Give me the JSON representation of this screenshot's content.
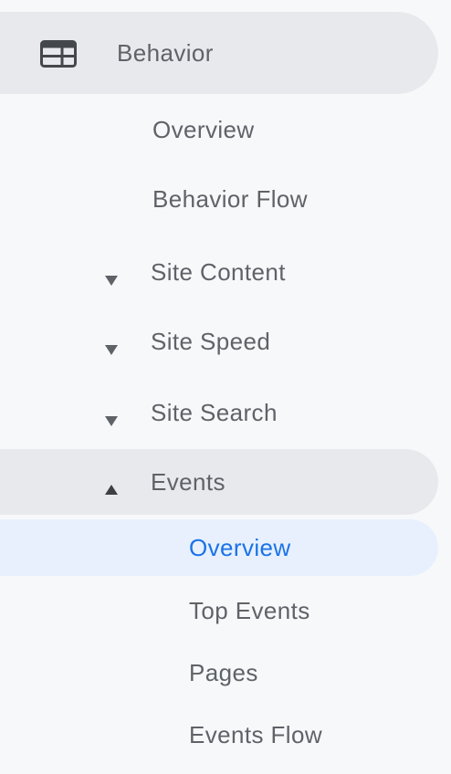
{
  "section": {
    "icon": "web-layout-icon",
    "label": "Behavior"
  },
  "items": {
    "overview": "Overview",
    "behavior_flow": "Behavior Flow"
  },
  "groups": {
    "site_content": {
      "label": "Site Content",
      "icon": "caret-down-icon"
    },
    "site_speed": {
      "label": "Site Speed",
      "icon": "caret-down-icon"
    },
    "site_search": {
      "label": "Site Search",
      "icon": "caret-down-icon"
    },
    "events": {
      "label": "Events",
      "icon": "caret-up-icon",
      "children": {
        "overview": "Overview",
        "top_events": "Top Events",
        "pages": "Pages",
        "events_flow": "Events Flow"
      }
    }
  },
  "colors": {
    "background": "#f7f8fa",
    "highlight": "#e8e9ec",
    "active_bg": "#e8f0fe",
    "active_text": "#1a73e8",
    "text": "#5f6368"
  }
}
